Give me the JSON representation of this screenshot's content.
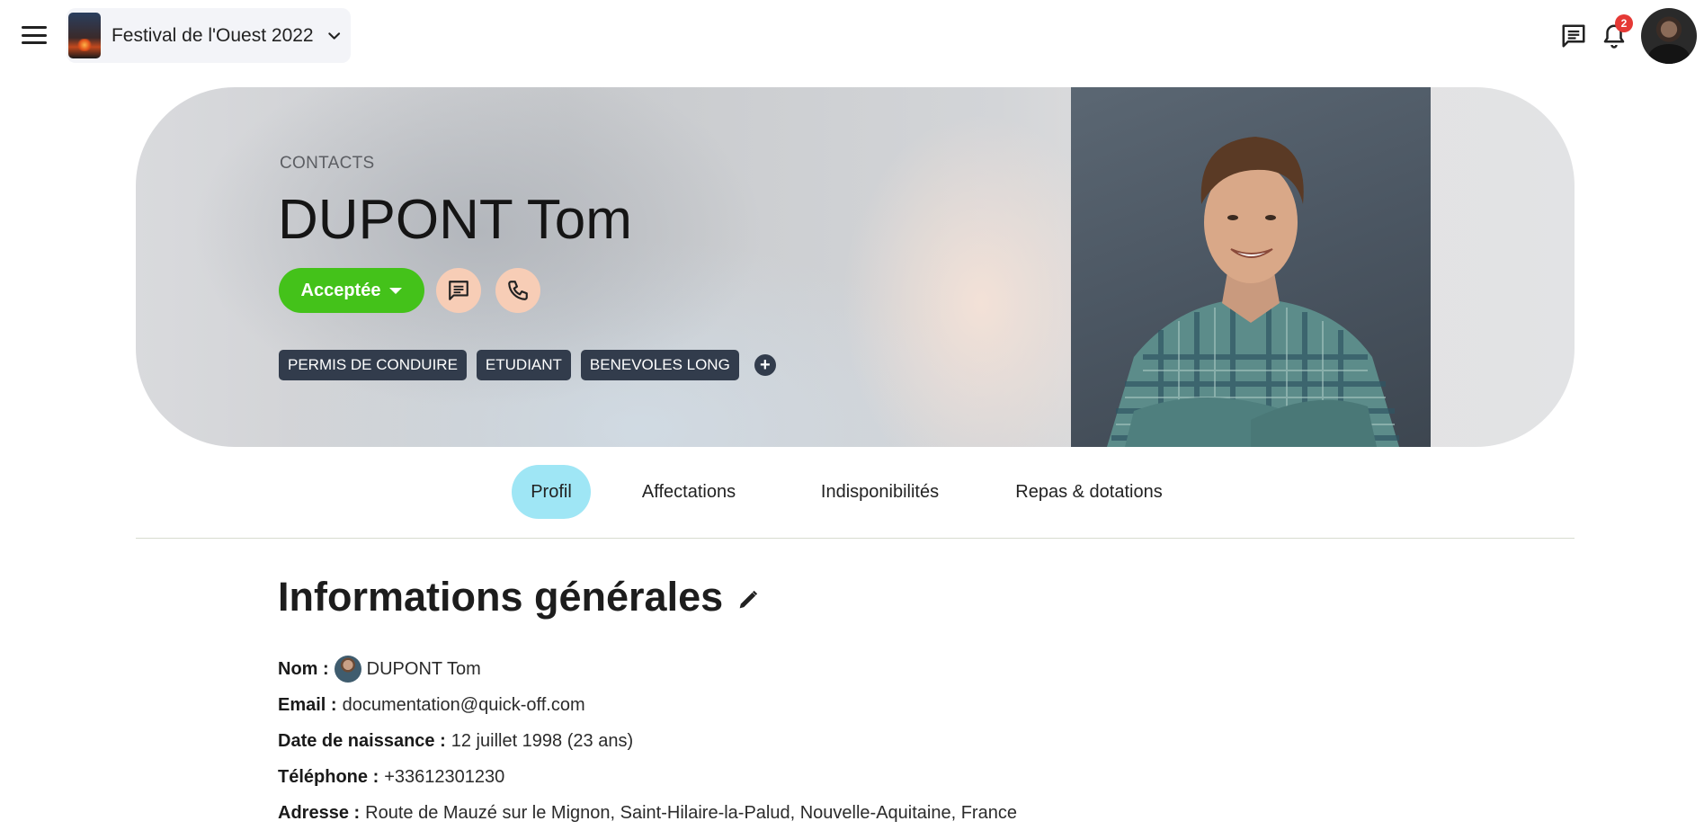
{
  "topbar": {
    "event_name": "Festival de l'Ouest 2022",
    "notification_count": "2"
  },
  "hero": {
    "section_label": "CONTACTS",
    "name": "DUPONT Tom",
    "status_label": "Acceptée",
    "status_color": "#44c21a",
    "tags": [
      "PERMIS DE CONDUIRE",
      "ETUDIANT",
      "BENEVOLES LONG"
    ]
  },
  "tabs": [
    {
      "label": "Profil",
      "active": true
    },
    {
      "label": "Affectations",
      "active": false
    },
    {
      "label": "Indisponibilités",
      "active": false
    },
    {
      "label": "Repas & dotations",
      "active": false
    }
  ],
  "general_info": {
    "title": "Informations générales",
    "fields": [
      {
        "label": "Nom :",
        "value": "DUPONT Tom"
      },
      {
        "label": "Email :",
        "value": "documentation@quick-off.com"
      },
      {
        "label": "Date de naissance :",
        "value": "12 juillet 1998 (23 ans)"
      },
      {
        "label": "Téléphone :",
        "value": "+33612301230"
      },
      {
        "label": "Adresse :",
        "value": "Route de Mauzé sur le Mignon, Saint-Hilaire-la-Palud, Nouvelle-Aquitaine, France"
      }
    ]
  },
  "icons": {
    "menu": "hamburger-menu-icon",
    "chevron": "chevron-down-icon",
    "chat": "chat-icon",
    "bell": "bell-icon",
    "message": "message-icon",
    "phone": "phone-icon",
    "add": "plus-icon",
    "edit": "pencil-icon"
  }
}
